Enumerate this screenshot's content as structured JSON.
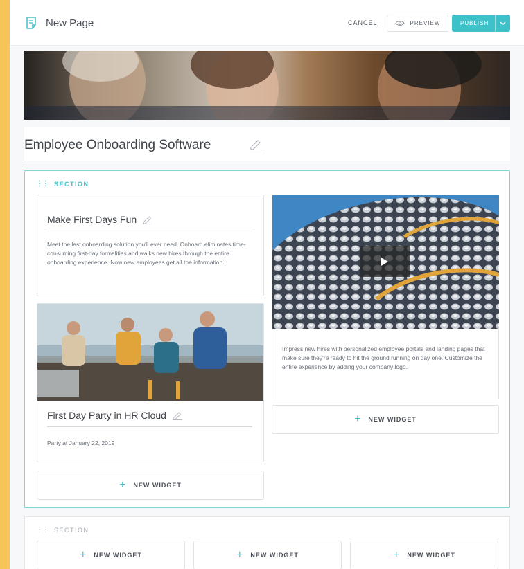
{
  "header": {
    "page_title": "New Page",
    "cancel_label": "CANCEL",
    "preview_label": "PREVIEW",
    "publish_label": "PUBLISH"
  },
  "page": {
    "heading": "Employee Onboarding Software"
  },
  "sections": [
    {
      "label": "SECTION",
      "left_column": {
        "text_card": {
          "title": "Make First Days Fun",
          "body": "Meet the last onboarding solution you'll ever need. Onboard eliminates time-consuming first-day formalities and walks new hires through the entire onboarding experience. Now new employees get all the information."
        },
        "event_card": {
          "title": "First Day Party in HR Cloud",
          "subtitle": "Party at January 22, 2019"
        },
        "new_widget_label": "NEW WIDGET"
      },
      "right_column": {
        "video_card_body": "Impress new hires with personalized employee portals and landing pages that make sure they're ready to hit the ground running on day one. Customize the entire experience by adding your company logo.",
        "new_widget_label": "NEW WIDGET"
      }
    },
    {
      "label": "SECTION",
      "new_widget_labels": [
        "NEW WIDGET",
        "NEW WIDGET",
        "NEW WIDGET"
      ]
    }
  ],
  "colors": {
    "accent": "#3fc1c9",
    "background_border": "#f7c45a"
  }
}
